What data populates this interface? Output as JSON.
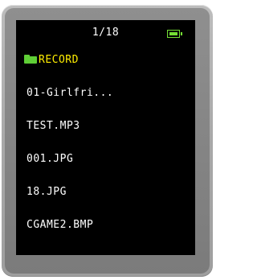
{
  "header": {
    "page_indicator": "1/18"
  },
  "status": {
    "battery_icon": "battery-icon",
    "battery_color": "#74e034"
  },
  "folder": {
    "icon": "folder-icon",
    "name": "RECORD",
    "color": "#ffee00"
  },
  "files": [
    {
      "name": "01-Girlfri..."
    },
    {
      "name": "TEST.MP3"
    },
    {
      "name": "001.JPG"
    },
    {
      "name": "18.JPG"
    },
    {
      "name": "CGAME2.BMP"
    }
  ]
}
